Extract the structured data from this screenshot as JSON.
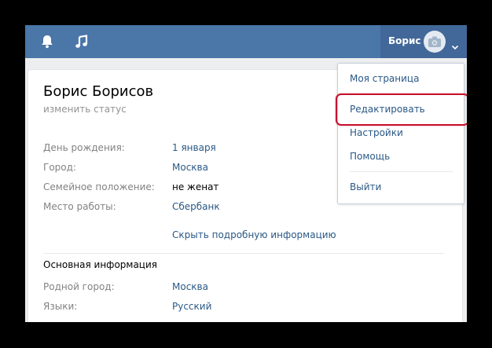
{
  "header": {
    "user_name": "Борис",
    "icons": [
      "bell-icon",
      "music-icon",
      "camera-icon",
      "chevron-down-icon"
    ],
    "colors": {
      "bar": "#4a76a8",
      "user_area": "#42689a"
    }
  },
  "profile": {
    "name": "Борис Борисов",
    "status_placeholder": "изменить статус",
    "rows": [
      {
        "label": "День рождения:",
        "value": "1 января"
      },
      {
        "label": "Город:",
        "value": "Москва"
      },
      {
        "label": "Семейное положение:",
        "value": "не женат"
      },
      {
        "label": "Место работы:",
        "value": "Сбербанк"
      }
    ],
    "hide_details_link": "Скрыть подробную информацию",
    "main_section": {
      "title": "Основная информация",
      "rows": [
        {
          "label": "Родной город:",
          "value": "Москва"
        },
        {
          "label": "Языки:",
          "value": "Русский"
        }
      ]
    }
  },
  "menu": {
    "items": [
      "Моя страница",
      "Редактировать",
      "Настройки",
      "Помощь",
      "Выйти"
    ],
    "highlighted": "Редактировать",
    "highlight_color": "#c8102e"
  },
  "colors": {
    "link": "#2a5885",
    "label": "#828282",
    "background": "#edeef0"
  }
}
